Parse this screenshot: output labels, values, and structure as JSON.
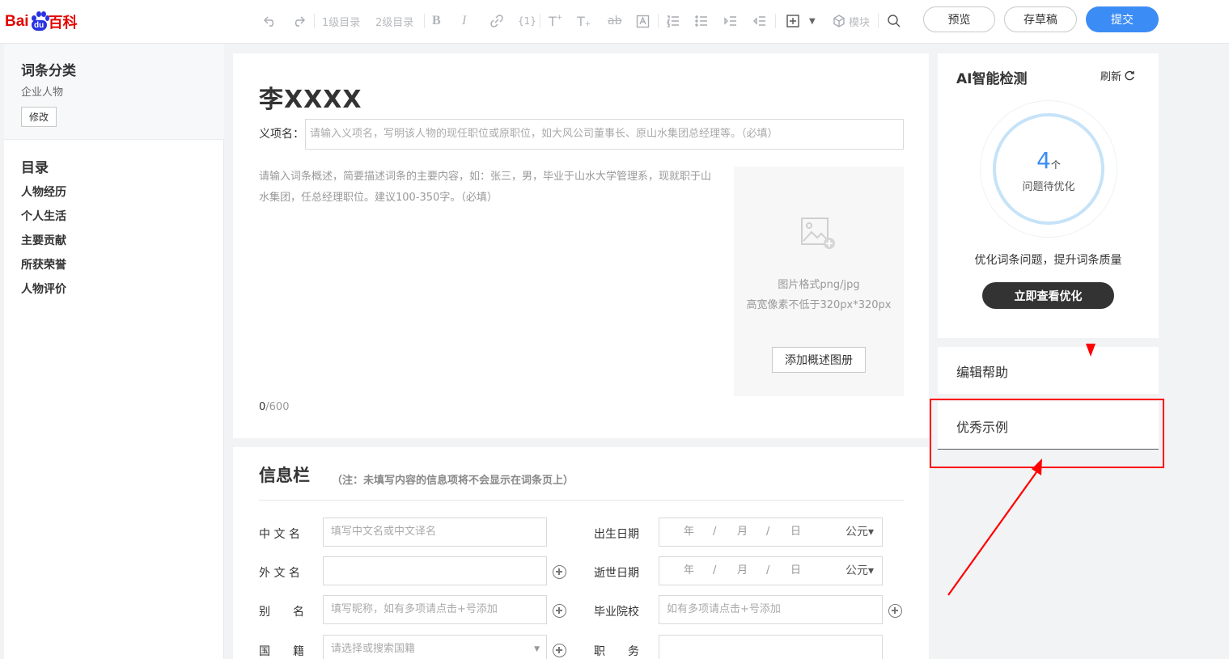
{
  "brand": {
    "bai": "Bai",
    "du": "du",
    "baike": "百科"
  },
  "toolbar": {
    "level1": "1级目录",
    "level2": "2级目录",
    "module": "模块",
    "preview": "预览",
    "draft": "存草稿",
    "submit": "提交"
  },
  "sidebar": {
    "category_title": "词条分类",
    "category_value": "企业人物",
    "modify": "修改",
    "toc_title": "目录",
    "items": [
      {
        "label": "人物经历"
      },
      {
        "label": "个人生活"
      },
      {
        "label": "主要贡献"
      },
      {
        "label": "所获荣誉"
      },
      {
        "label": "人物评价"
      }
    ]
  },
  "main": {
    "title": "李XXXX",
    "sense_label": "义项名：",
    "sense_placeholder": "请输入义项名，写明该人物的现任职位或原职位，如大风公司董事长、原山水集团总经理等。（必填）",
    "summary_placeholder": "请输入词条概述，简要描述词条的主要内容，如：张三，男，毕业于山水大学管理系，现就职于山水集团，任总经理职位。建议100-350字。（必填）",
    "count_current": "0",
    "count_max": "/600",
    "image_hint_1": "图片格式png/jpg",
    "image_hint_2": "高宽像素不低于320px*320px",
    "image_button": "添加概述图册"
  },
  "info": {
    "title": "信息栏",
    "note": "（注：未填写内容的信息项将不会显示在词条页上）",
    "fields": {
      "chinese_name": {
        "label": "中 文 名",
        "placeholder": "填写中文名或中文译名"
      },
      "foreign_name": {
        "label": "外 文 名",
        "placeholder": ""
      },
      "alias": {
        "label": "别　　名",
        "placeholder": "填写昵称，如有多项请点击+号添加"
      },
      "nationality": {
        "label": "国　　籍",
        "placeholder": "请选择或搜索国籍"
      },
      "birth_date": {
        "label": "出生日期",
        "year": "年",
        "month": "月",
        "day": "日",
        "sep": "/",
        "era": "公元▾"
      },
      "death_date": {
        "label": "逝世日期",
        "year": "年",
        "month": "月",
        "day": "日",
        "sep": "/",
        "era": "公元▾"
      },
      "school": {
        "label": "毕业院校",
        "placeholder": "如有多项请点击+号添加"
      },
      "position": {
        "label": "职　　务",
        "placeholder": ""
      }
    }
  },
  "ai": {
    "title": "AI智能检测",
    "refresh": "刷新",
    "count": "4",
    "unit": "个",
    "subtitle": "问题待优化",
    "desc": "优化词条问题，提升词条质量",
    "button": "立即查看优化"
  },
  "help": {
    "label": "编辑帮助"
  },
  "examples": {
    "label": "优秀示例"
  },
  "colors": {
    "brand_red": "#e10602",
    "brand_blue": "#2932e1",
    "accent": "#3c8cf5",
    "annotation": "#ff0000"
  }
}
